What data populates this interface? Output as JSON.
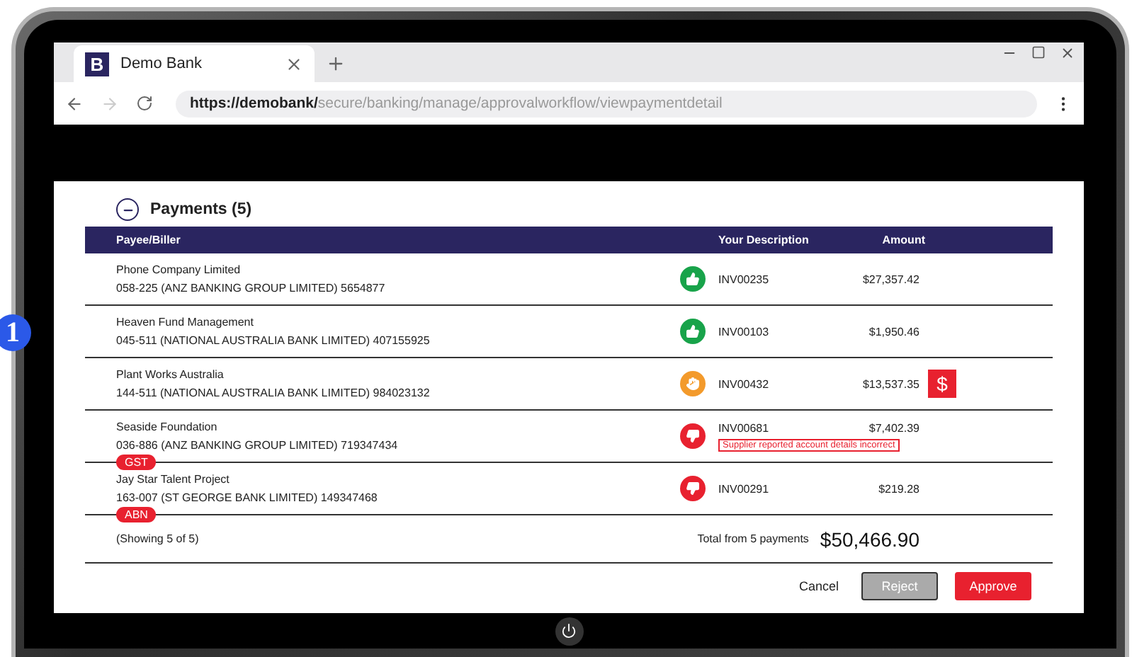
{
  "annotation_marker": "1",
  "browser": {
    "tab_logo": "B",
    "tab_title": "Demo Bank",
    "url_host": "https://demobank/",
    "url_path": "secure/banking/manage/approvalworkflow/viewpaymentdetail"
  },
  "section": {
    "title": "Payments (5)",
    "expanded": true
  },
  "table": {
    "columns": [
      "Payee/Biller",
      "Your Description",
      "Amount"
    ],
    "rows": [
      {
        "payee": "Phone Company Limited",
        "account": "058-225 (ANZ BANKING GROUP LIMITED) 5654877",
        "kind": "approved",
        "description": "INV00235",
        "amount": "$27,357.42"
      },
      {
        "payee": "Heaven Fund Management",
        "account": "045-511 (NATIONAL AUSTRALIA BANK LIMITED) 407155925",
        "kind": "approved",
        "description": "INV00103",
        "amount": "$1,950.46"
      },
      {
        "payee": "Plant Works Australia",
        "account": "144-511 (NATIONAL AUSTRALIA BANK LIMITED) 984023132",
        "kind": "pending",
        "description": "INV00432",
        "amount": "$13,537.35",
        "flag": "$"
      },
      {
        "payee": "Seaside Foundation",
        "account": "036-886 (ANZ BANKING GROUP LIMITED) 719347434",
        "kind": "rejected",
        "description": "INV00681",
        "amount": "$7,402.39",
        "note": "Supplier reported account details incorrect",
        "tag": "GST"
      },
      {
        "payee": "Jay Star Talent Project",
        "account": "163-007 (ST GEORGE BANK LIMITED) 149347468",
        "kind": "rejected",
        "description": "INV00291",
        "amount": "$219.28",
        "tag": "ABN"
      }
    ]
  },
  "footer": {
    "showing": "(Showing 5 of 5)",
    "total_label": "Total from 5 payments",
    "total": "$50,466.90"
  },
  "buttons": [
    {
      "label": "Cancel",
      "kind": "link",
      "disabled": false
    },
    {
      "label": "Reject",
      "kind": "secondary",
      "disabled": true
    },
    {
      "label": "Approve",
      "kind": "primary",
      "disabled": false
    }
  ]
}
